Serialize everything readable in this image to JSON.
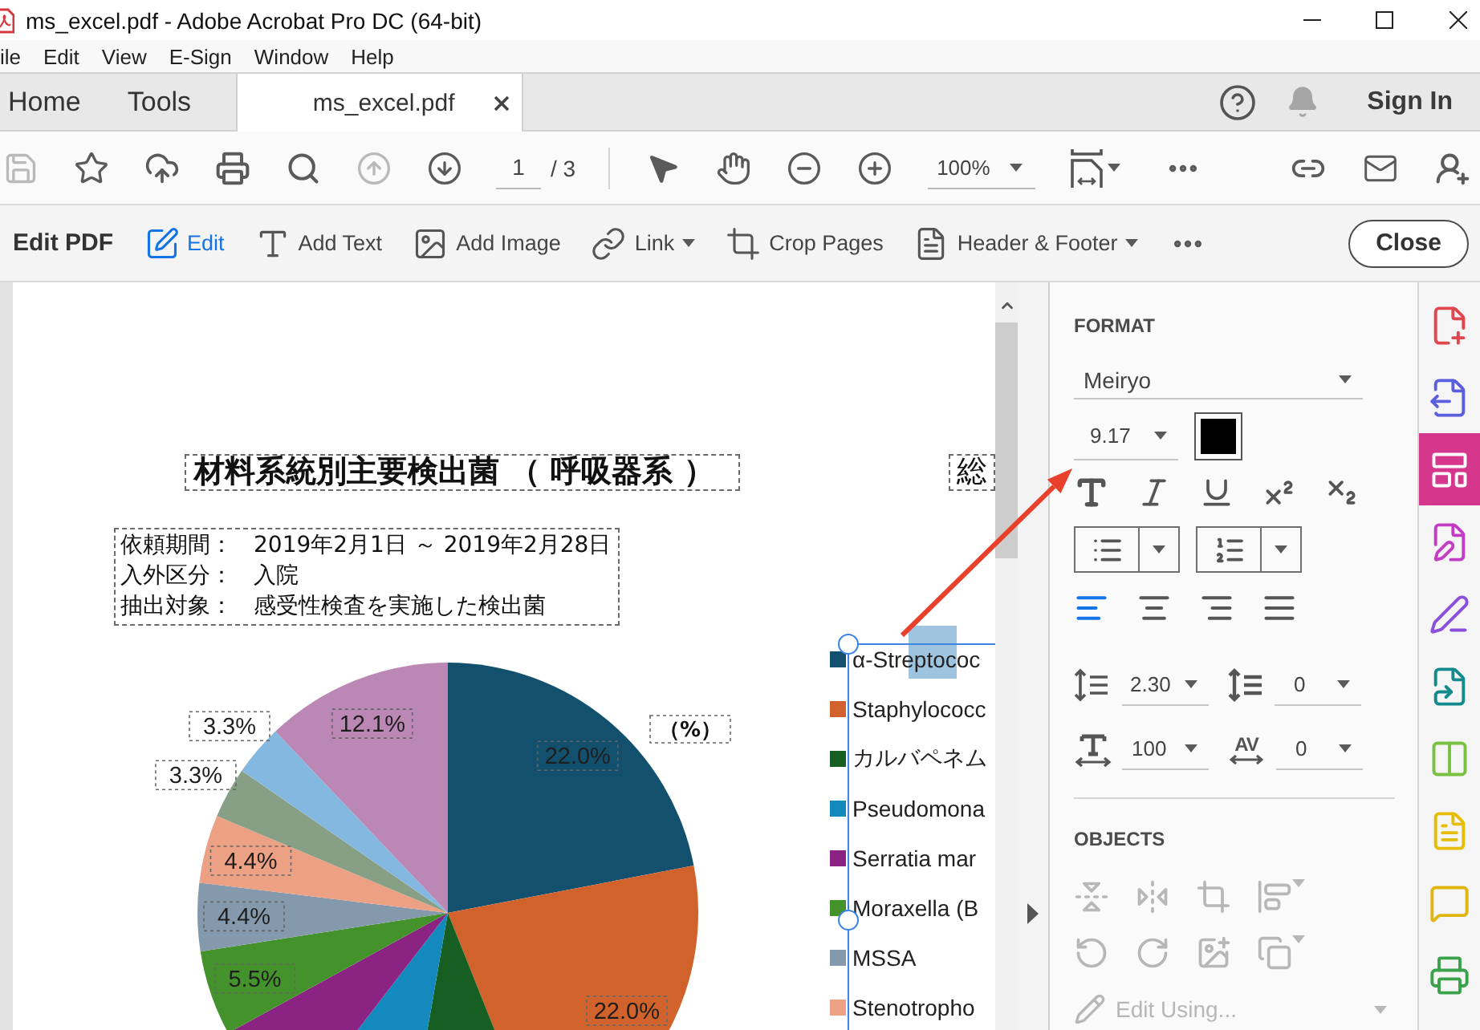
{
  "window": {
    "title": "ms_excel.pdf - Adobe Acrobat Pro DC (64-bit)"
  },
  "menu_bar": [
    "ile",
    "Edit",
    "View",
    "E-Sign",
    "Window",
    "Help"
  ],
  "tabs": [
    {
      "label": "Home",
      "kind": "home",
      "selected": false
    },
    {
      "label": "Tools",
      "kind": "home",
      "selected": false
    },
    {
      "label": "ms_excel.pdf",
      "kind": "document",
      "selected": true
    }
  ],
  "header_actions": {
    "sign_in": "Sign In"
  },
  "toolbar": {
    "save_disabled": true,
    "previous_page_disabled": true,
    "page_number": "1",
    "page_count": "/ 3",
    "zoom": "100%"
  },
  "edit_bar": {
    "title": "Edit PDF",
    "tools": [
      {
        "label": "Edit",
        "selected": true,
        "has_menu": false
      },
      {
        "label": "Add Text",
        "selected": false,
        "has_menu": false
      },
      {
        "label": "Add Image",
        "selected": false,
        "has_menu": false
      },
      {
        "label": "Link",
        "selected": false,
        "has_menu": true
      },
      {
        "label": "Crop Pages",
        "selected": false,
        "has_menu": false
      },
      {
        "label": "Header & Footer",
        "selected": false,
        "has_menu": true
      }
    ],
    "close": "Close"
  },
  "document": {
    "title": "材料系統別主要検出菌 （ 呼吸器系 ）",
    "second_title": "総",
    "info": [
      {
        "label": "依頼期間：",
        "value": "2019年2月1日 ～ 2019年2月28日"
      },
      {
        "label": "入外区分：",
        "value": "入院"
      },
      {
        "label": "抽出対象：",
        "value": "感受性検査を実施した検出菌"
      }
    ],
    "legend_selected": true,
    "chart_data": {
      "type": "pie",
      "categories": [
        "α-Streptococ",
        "Staphylococc",
        "カルバペネム",
        "Pseudomona",
        "Serratia mar",
        "Moraxella (B",
        "MSSA",
        "Stenotropho",
        null,
        null,
        null
      ],
      "series": [
        {
          "values": [
            22.0,
            22.0,
            8.8,
            7.7,
            6.6,
            5.5,
            4.4,
            4.4,
            3.3,
            3.3,
            12.1
          ],
          "colors": [
            "#13506e",
            "#d1622b",
            "#175e22",
            "#1389bd",
            "#8a2381",
            "#44922b",
            "#8499ab",
            "#eca084",
            "#87a085",
            "#85b8e0",
            "#bb87b4"
          ]
        }
      ],
      "value_labels": [
        "22.0%",
        "22.0%",
        null,
        null,
        null,
        "5.5%",
        "4.4%",
        "4.4%",
        "3.3%",
        "3.3%",
        "12.1%"
      ],
      "annotations": [
        {
          "text": "（%）"
        }
      ]
    }
  },
  "format": {
    "heading": "FORMAT",
    "font": "Meiryo",
    "size": "9.17",
    "color": "#000000",
    "alignments": [
      {
        "selected": true
      },
      {
        "selected": false
      },
      {
        "selected": false
      },
      {
        "selected": false
      }
    ],
    "line_spacing": "2.30",
    "paragraph_spacing": "0",
    "horizontal_scale": "100",
    "character_spacing": {
      "symbol": "AV",
      "value": "0"
    }
  },
  "objects": {
    "heading": "OBJECTS",
    "disabled": true,
    "edit_using": "Edit Using..."
  },
  "tools_rail": [
    {
      "selected": false,
      "color": "#e0464e"
    },
    {
      "selected": false,
      "color": "#5b5fde"
    },
    {
      "selected": true,
      "color": "#d4378c"
    },
    {
      "selected": false,
      "color": "#c23cc4"
    },
    {
      "selected": false,
      "color": "#8a4fdc"
    },
    {
      "selected": false,
      "color": "#138a8d"
    },
    {
      "selected": false,
      "color": "#7ac143"
    },
    {
      "selected": false,
      "color": "#e6bd00"
    },
    {
      "selected": false,
      "color": "#e1b50f"
    },
    {
      "selected": false,
      "color": "#3aa24b"
    }
  ]
}
